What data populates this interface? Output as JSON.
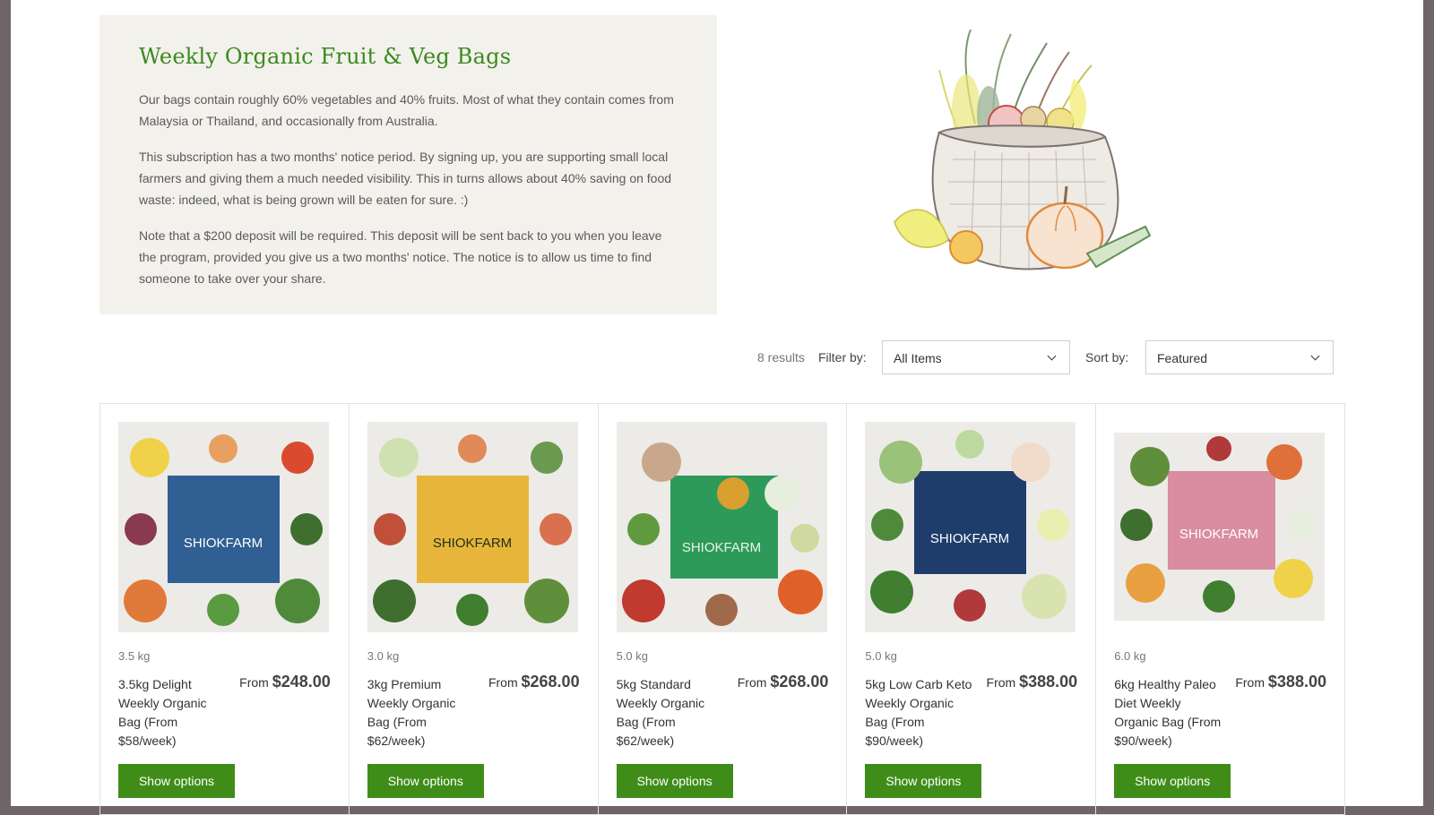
{
  "intro": {
    "title": "Weekly Organic Fruit & Veg Bags",
    "paragraphs": [
      "Our bags contain roughly 60% vegetables and 40% fruits. Most of what they contain comes from Malaysia or Thailand, and occasionally from Australia.",
      "This subscription has a two months' notice period. By signing up, you are supporting small local farmers and giving them a much needed visibility. This in turns allows about 40% saving on food waste: indeed, what is being grown will be eaten for sure. :)",
      "Note that a $200 deposit will be required. This deposit will be sent back to you when you leave the program, provided you give us a two months' notice. The notice is to allow us time to find someone to take over your share."
    ]
  },
  "toolbar": {
    "results": "8 results",
    "filter_label": "Filter by:",
    "filter_value": "All Items",
    "sort_label": "Sort by:",
    "sort_value": "Featured"
  },
  "colors": {
    "accent": "#3f8d18",
    "title": "#3b8a1f",
    "intro_bg": "#f3f1ec"
  },
  "products": [
    {
      "weight": "3.5 kg",
      "name": "3.5kg Delight Weekly Organic Bag (From $58/week)",
      "price_prefix": "From",
      "price": "$248.00",
      "button": "Show options",
      "bag_color": "#2f5f93",
      "bag_text": "SHIOKFARM"
    },
    {
      "weight": "3.0 kg",
      "name": "3kg Premium Weekly Organic Bag (From $62/week)",
      "price_prefix": "From",
      "price": "$268.00",
      "button": "Show options",
      "bag_color": "#e7b53a",
      "bag_text": "SHIOKFARM"
    },
    {
      "weight": "5.0 kg",
      "name": "5kg Standard Weekly Organic Bag (From $62/week)",
      "price_prefix": "From",
      "price": "$268.00",
      "button": "Show options",
      "bag_color": "#2e9a5a",
      "bag_text": "SHIOKFARM"
    },
    {
      "weight": "5.0 kg",
      "name": "5kg Low Carb Keto Weekly Organic Bag (From $90/week)",
      "price_prefix": "From",
      "price": "$388.00",
      "button": "Show options",
      "bag_color": "#1f3d6b",
      "bag_text": "SHIOKFARM"
    },
    {
      "weight": "6.0 kg",
      "name": "6kg Healthy Paleo Diet Weekly Organic Bag (From $90/week)",
      "price_prefix": "From",
      "price": "$388.00",
      "button": "Show options",
      "bag_color": "#d98da0",
      "bag_text": "SHIOKFARM"
    }
  ]
}
